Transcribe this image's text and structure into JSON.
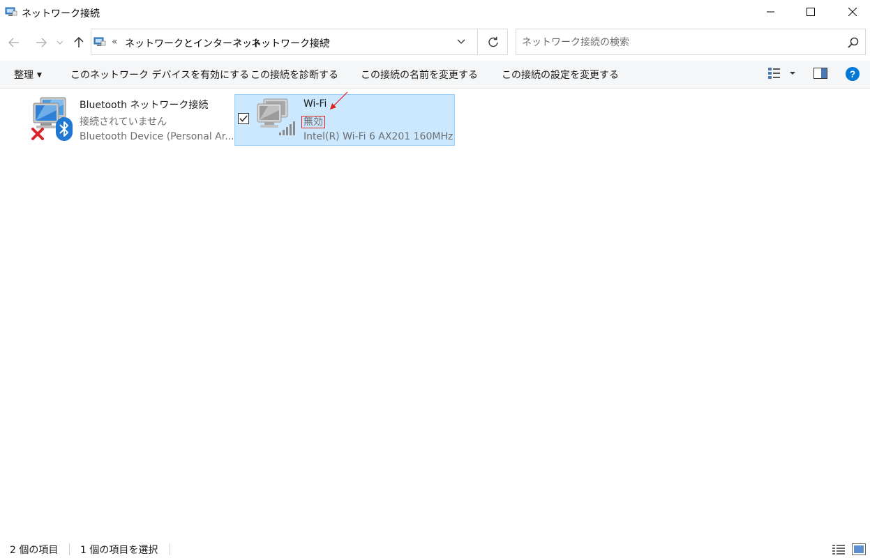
{
  "window": {
    "title": "ネットワーク接続",
    "minimize_glyph": "—",
    "maximize_glyph": "☐",
    "close_glyph": "✕"
  },
  "address": {
    "overflow": "«",
    "crumbs": [
      "ネットワークとインターネット",
      "ネットワーク接続"
    ],
    "separator": "›"
  },
  "search": {
    "placeholder": "ネットワーク接続の検索"
  },
  "commands": {
    "organize": "整理",
    "enable_device": "このネットワーク デバイスを有効にする",
    "diagnose": "この接続を診断する",
    "rename": "この接続の名前を変更する",
    "change_settings": "この接続の設定を変更する"
  },
  "items": [
    {
      "name": "Bluetooth ネットワーク接続",
      "status": "接続されていません",
      "device": "Bluetooth Device (Personal Ar...",
      "selected": false
    },
    {
      "name": "Wi-Fi",
      "status": "無効",
      "device": "Intel(R) Wi-Fi 6 AX201 160MHz",
      "selected": true
    }
  ],
  "statusbar": {
    "item_count": "2 個の項目",
    "selected_count": "1 個の項目を選択"
  },
  "colors": {
    "selection_bg": "#cce8ff",
    "selection_border": "#99d1ff",
    "annotation_red": "#e02020",
    "help_blue": "#0078d7"
  },
  "icons": {
    "window": "network-folder-icon",
    "back": "back-arrow-icon",
    "forward": "forward-arrow-icon",
    "up": "up-arrow-icon",
    "refresh": "refresh-icon",
    "search": "search-icon",
    "view": "view-options-icon",
    "preview": "preview-pane-icon",
    "help": "help-icon"
  }
}
